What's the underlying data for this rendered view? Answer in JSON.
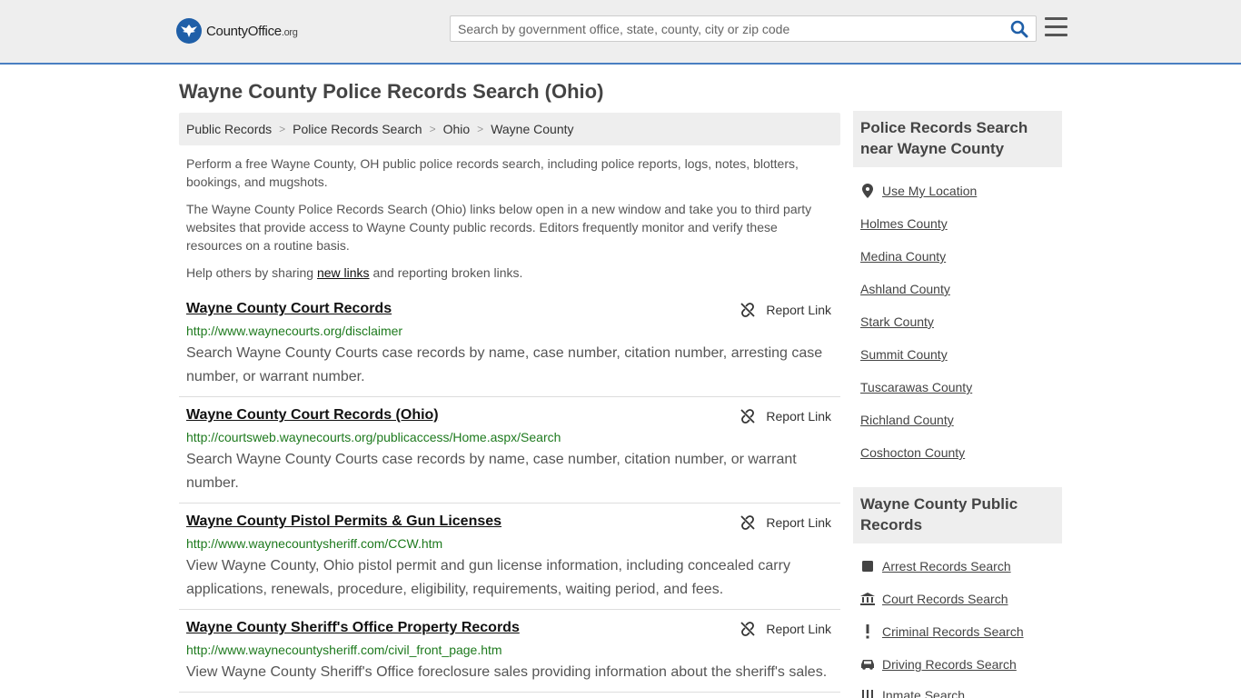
{
  "header": {
    "logo_main": "CountyOffice",
    "logo_tld": ".org",
    "search_placeholder": "Search by government office, state, county, city or zip code"
  },
  "page_title": "Wayne County Police Records Search (Ohio)",
  "breadcrumb": [
    "Public Records",
    "Police Records Search",
    "Ohio",
    "Wayne County"
  ],
  "intro": {
    "p1": "Perform a free Wayne County, OH public police records search, including police reports, logs, notes, blotters, bookings, and mugshots.",
    "p2": "The Wayne County Police Records Search (Ohio) links below open in a new window and take you to third party websites that provide access to Wayne County public records. Editors frequently monitor and verify these resources on a routine basis.",
    "p3_before": "Help others by sharing ",
    "p3_link": "new links",
    "p3_after": " and reporting broken links."
  },
  "report_label": "Report Link",
  "results": [
    {
      "title": "Wayne County Court Records",
      "url": "http://www.waynecourts.org/disclaimer",
      "desc": "Search Wayne County Courts case records by name, case number, citation number, arresting case number, or warrant number."
    },
    {
      "title": "Wayne County Court Records (Ohio)",
      "url": "http://courtsweb.waynecourts.org/publicaccess/Home.aspx/Search",
      "desc": "Search Wayne County Courts case records by name, case number, citation number, or warrant number."
    },
    {
      "title": "Wayne County Pistol Permits & Gun Licenses",
      "url": "http://www.waynecountysheriff.com/CCW.htm",
      "desc": "View Wayne County, Ohio pistol permit and gun license information, including concealed carry applications, renewals, procedure, eligibility, requirements, waiting period, and fees."
    },
    {
      "title": "Wayne County Sheriff's Office Property Records",
      "url": "http://www.waynecountysheriff.com/civil_front_page.htm",
      "desc": "View Wayne County Sheriff's Office foreclosure sales providing information about the sheriff's sales."
    }
  ],
  "sidebar": {
    "nearby_title": "Police Records Search near Wayne County",
    "use_location": "Use My Location",
    "nearby": [
      "Holmes County",
      "Medina County",
      "Ashland County",
      "Stark County",
      "Summit County",
      "Tuscarawas County",
      "Richland County",
      "Coshocton County"
    ],
    "public_title": "Wayne County Public Records",
    "public_links": [
      {
        "label": "Arrest Records Search",
        "icon": "square-icon"
      },
      {
        "label": "Court Records Search",
        "icon": "courthouse-icon"
      },
      {
        "label": "Criminal Records Search",
        "icon": "exclamation-icon"
      },
      {
        "label": "Driving Records Search",
        "icon": "car-icon"
      },
      {
        "label": "Inmate Search",
        "icon": "inmate-icon"
      }
    ]
  },
  "colors": {
    "accent": "#4a7fc1",
    "logo_blue": "#1f5fa8",
    "url_green": "#1e7a1e",
    "panel_gray": "#eeeeee"
  }
}
